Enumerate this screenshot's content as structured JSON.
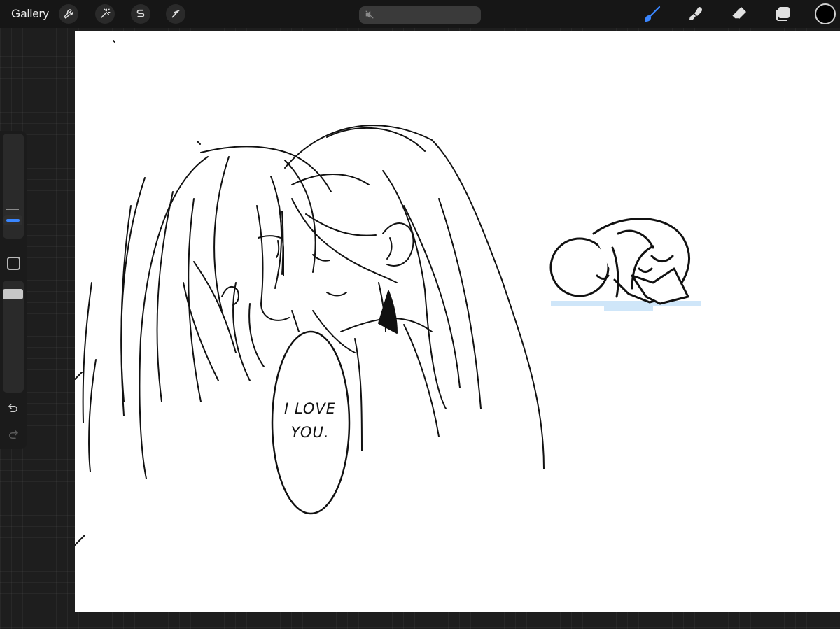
{
  "topbar": {
    "gallery_label": "Gallery",
    "left_tools": [
      "wrench-icon",
      "magic-wand-icon",
      "selection-s-icon",
      "transform-arrow-icon"
    ],
    "status_icon": "muted-icon",
    "right_tools": [
      "brush-icon",
      "smudge-icon",
      "eraser-icon",
      "layers-icon"
    ],
    "active_tool": "brush",
    "current_color": "#000000",
    "accent_color": "#3a86ff"
  },
  "sidebar": {
    "controls": [
      "brush-size-slider",
      "modify-button",
      "opacity-slider",
      "undo-button",
      "redo-button"
    ]
  },
  "canvas": {
    "speech_bubble": {
      "line1": "I LOVE",
      "line2": "YOU."
    },
    "puddle_color": "#cfe6f9"
  }
}
